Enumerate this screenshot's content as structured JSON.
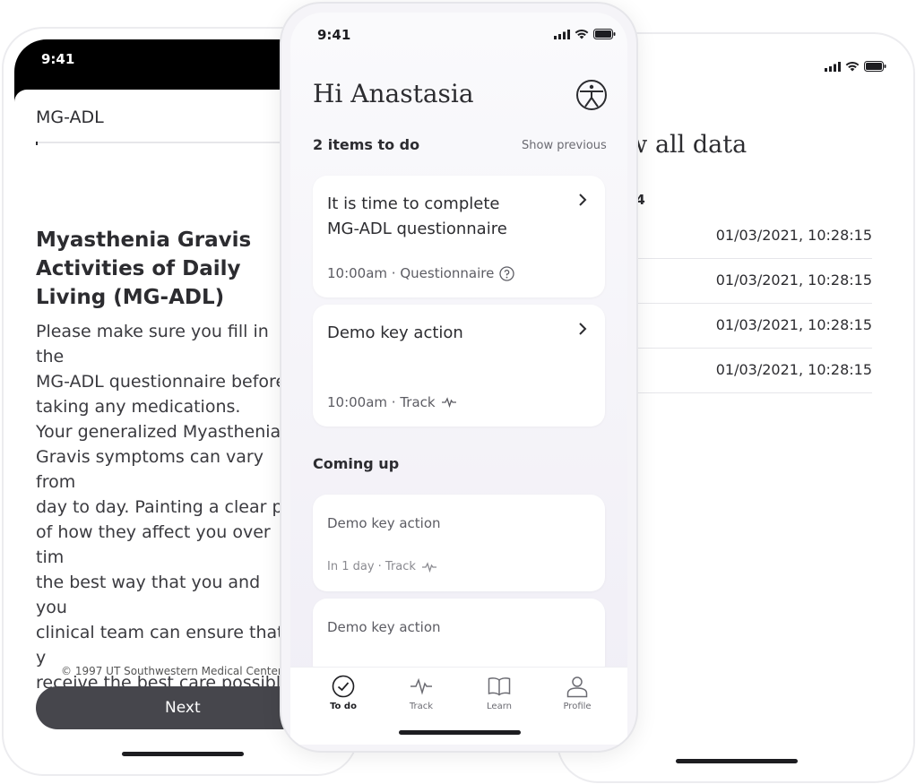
{
  "left_screen": {
    "time": "9:41",
    "header": "MG-ADL",
    "title": "Myasthenia Gravis Activities of Daily Living (MG-ADL)",
    "paragraph1": "Please make sure you fill in the\nMG-ADL questionnaire before\ntaking any medications.",
    "paragraph2": "Your generalized Myasthenia\nGravis symptoms can vary from\nday to day. Painting a clear pi\nof how they affect you over tim\nthe best way that you and you\nclinical team can ensure that y\nreceive the best care possible",
    "copyright": "© 1997 UT Southwestern Medical Center, Da",
    "next_label": "Next"
  },
  "center_screen": {
    "time": "9:41",
    "greeting": "Hi Anastasia",
    "todo_count": "2 items to do",
    "show_previous": "Show previous",
    "todo_cards": [
      {
        "title": "It is time to complete\nMG-ADL questionnaire",
        "meta": "10:00am · Questionnaire"
      },
      {
        "title": "Demo key action",
        "meta": "10:00am · Track"
      }
    ],
    "coming_up_title": "Coming up",
    "upcoming_cards": [
      {
        "title": "Demo key action",
        "meta": "In 1 day · Track"
      },
      {
        "title": "Demo key action"
      }
    ],
    "tabs": [
      {
        "label": "To do",
        "icon": "check-circle-icon",
        "active": true
      },
      {
        "label": "Track",
        "icon": "pulse-icon"
      },
      {
        "label": "Learn",
        "icon": "book-icon"
      },
      {
        "label": "Profile",
        "icon": "person-icon"
      }
    ]
  },
  "right_screen": {
    "title": "ow all data",
    "group_label": "24",
    "rows": [
      "01/03/2021, 10:28:15",
      "01/03/2021, 10:28:15",
      "01/03/2021, 10:28:15",
      "01/03/2021, 10:28:15"
    ]
  },
  "colors": {
    "button_dark": "#46464c",
    "text_primary": "#2c2c30",
    "background_center": "#f5f4f8"
  }
}
